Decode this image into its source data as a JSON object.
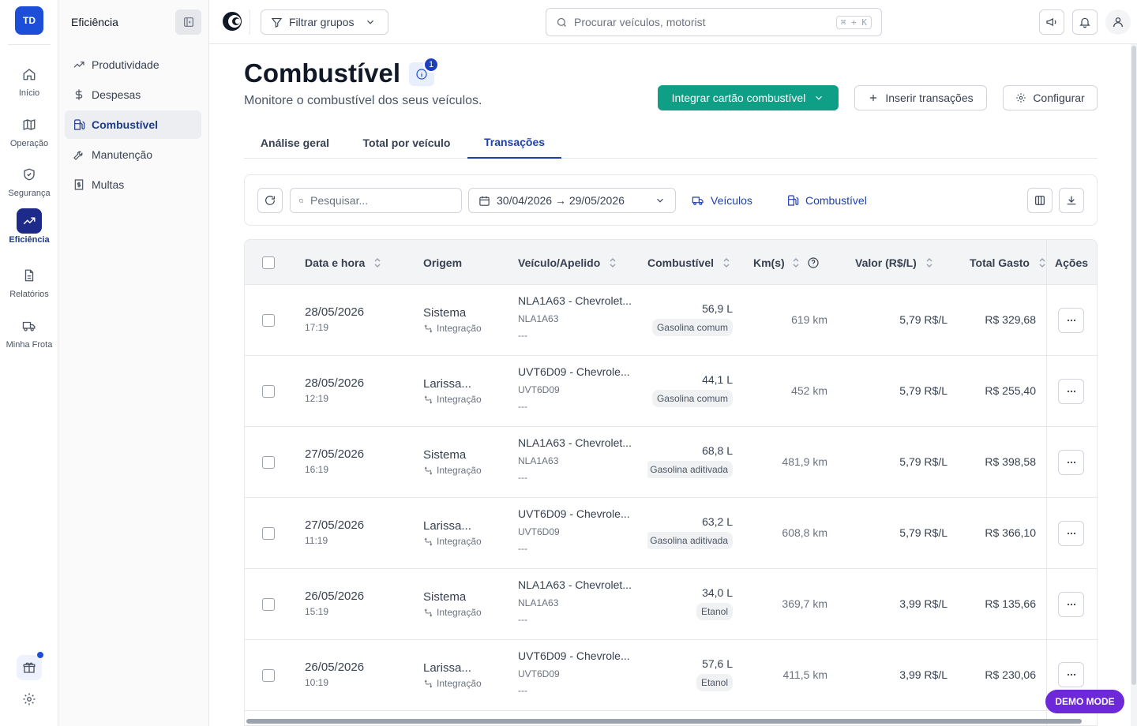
{
  "rail": {
    "avatar": "TD",
    "items": [
      {
        "label": "Início",
        "icon": "home-icon"
      },
      {
        "label": "Operação",
        "icon": "map-icon"
      },
      {
        "label": "Segurança",
        "icon": "shield-icon"
      },
      {
        "label": "Eficiência",
        "icon": "trending-up-icon",
        "active": true
      },
      {
        "label": "Relatórios",
        "icon": "file-icon"
      },
      {
        "label": "Minha Frota",
        "icon": "truck-icon"
      }
    ]
  },
  "subnav": {
    "title": "Eficiência",
    "items": [
      {
        "label": "Produtividade",
        "icon": "trend-icon"
      },
      {
        "label": "Despesas",
        "icon": "dollar-icon"
      },
      {
        "label": "Combustível",
        "icon": "fuel-icon",
        "active": true
      },
      {
        "label": "Manutenção",
        "icon": "wrench-icon"
      },
      {
        "label": "Multas",
        "icon": "receipt-icon"
      }
    ]
  },
  "topbar": {
    "filter_label": "Filtrar grupos",
    "search_placeholder": "Procurar veículos, motorist",
    "search_shortcut": "⌘ + K"
  },
  "page": {
    "title": "Combustível",
    "info_badge": "1",
    "subtitle": "Monitore o combustível dos seus veículos.",
    "primary_button": "Integrar cartão combustível",
    "insert_button": "Inserir transações",
    "config_button": "Configurar"
  },
  "tabs": [
    {
      "label": "Análise geral"
    },
    {
      "label": "Total por veículo"
    },
    {
      "label": "Transações",
      "active": true
    }
  ],
  "toolbar": {
    "search_placeholder": "Pesquisar...",
    "date_range": "30/04/2026 → 29/05/2026",
    "vehicles_link": "Veículos",
    "fuel_link": "Combustível"
  },
  "table": {
    "headers": {
      "date": "Data e hora",
      "origin": "Origem",
      "vehicle": "Veículo/Apelido",
      "fuel": "Combustível",
      "km": "Km(s)",
      "value": "Valor (R$/L)",
      "total": "Total Gasto",
      "actions": "Ações"
    },
    "rows": [
      {
        "date": "28/05/2026",
        "time": "17:19",
        "origin": "Sistema",
        "source": "Integração",
        "vehicle": "NLA1A63 - Chevrolet...",
        "plate": "NLA1A63",
        "nickname": "---",
        "liters": "56,9 L",
        "fuel_type": "Gasolina comum",
        "km": "619 km",
        "price": "5,79 R$/L",
        "total": "R$ 329,68"
      },
      {
        "date": "28/05/2026",
        "time": "12:19",
        "origin": "Larissa...",
        "source": "Integração",
        "vehicle": "UVT6D09 - Chevrole...",
        "plate": "UVT6D09",
        "nickname": "---",
        "liters": "44,1 L",
        "fuel_type": "Gasolina comum",
        "km": "452 km",
        "price": "5,79 R$/L",
        "total": "R$ 255,40"
      },
      {
        "date": "27/05/2026",
        "time": "16:19",
        "origin": "Sistema",
        "source": "Integração",
        "vehicle": "NLA1A63 - Chevrolet...",
        "plate": "NLA1A63",
        "nickname": "---",
        "liters": "68,8 L",
        "fuel_type": "Gasolina aditivada",
        "km": "481,9 km",
        "price": "5,79 R$/L",
        "total": "R$ 398,58"
      },
      {
        "date": "27/05/2026",
        "time": "11:19",
        "origin": "Larissa...",
        "source": "Integração",
        "vehicle": "UVT6D09 - Chevrole...",
        "plate": "UVT6D09",
        "nickname": "---",
        "liters": "63,2 L",
        "fuel_type": "Gasolina aditivada",
        "km": "608,8 km",
        "price": "5,79 R$/L",
        "total": "R$ 366,10"
      },
      {
        "date": "26/05/2026",
        "time": "15:19",
        "origin": "Sistema",
        "source": "Integração",
        "vehicle": "NLA1A63 - Chevrolet...",
        "plate": "NLA1A63",
        "nickname": "---",
        "liters": "34,0 L",
        "fuel_type": "Etanol",
        "km": "369,7 km",
        "price": "3,99 R$/L",
        "total": "R$ 135,66"
      },
      {
        "date": "26/05/2026",
        "time": "10:19",
        "origin": "Larissa...",
        "source": "Integração",
        "vehicle": "UVT6D09 - Chevrole...",
        "plate": "UVT6D09",
        "nickname": "---",
        "liters": "57,6 L",
        "fuel_type": "Etanol",
        "km": "411,5 km",
        "price": "3,99 R$/L",
        "total": "R$ 230,06"
      }
    ]
  },
  "demo_badge": "DEMO MODE",
  "colors": {
    "primary": "#0f9e86",
    "accent": "#1e40af",
    "demo": "#6d28d9"
  }
}
